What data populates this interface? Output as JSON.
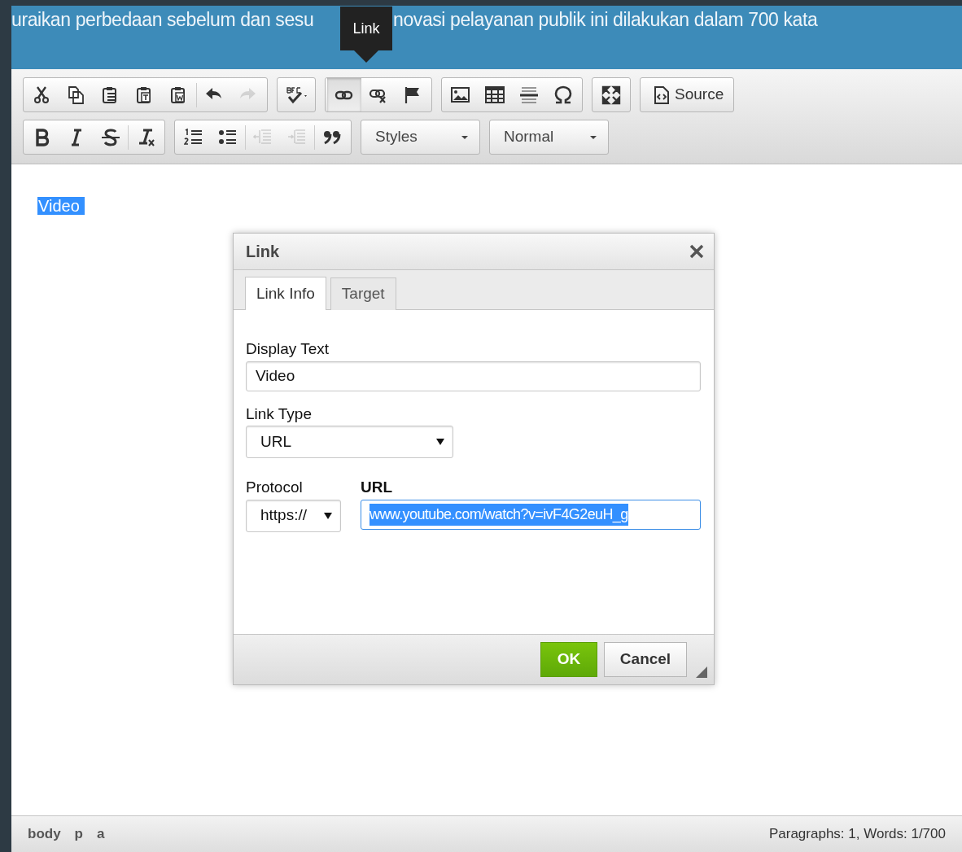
{
  "header": {
    "text_before": "uraikan perbedaan sebelum dan sesu",
    "text_after": "novasi pelayanan publik ini dilakukan dalam 700 kata"
  },
  "tooltip": {
    "text": "Link"
  },
  "toolbar": {
    "rows": [
      {
        "groups": [
          {
            "items": [
              {
                "kind": "cut",
                "disabled": false,
                "pressed": false
              },
              {
                "kind": "copy",
                "disabled": false,
                "pressed": false
              },
              {
                "kind": "paste",
                "disabled": false,
                "pressed": false
              },
              {
                "kind": "paste-text",
                "disabled": false,
                "pressed": false
              },
              {
                "kind": "paste-word",
                "disabled": false,
                "pressed": false
              },
              {
                "kind": "separator"
              },
              {
                "kind": "undo",
                "disabled": false,
                "pressed": false
              },
              {
                "kind": "redo",
                "disabled": true,
                "pressed": false
              }
            ]
          },
          {
            "items": [
              {
                "kind": "spellcheck",
                "disabled": false,
                "pressed": false
              }
            ]
          },
          {
            "items": [
              {
                "kind": "link",
                "disabled": false,
                "pressed": true
              },
              {
                "kind": "unlink",
                "disabled": false,
                "pressed": false
              },
              {
                "kind": "anchor",
                "disabled": false,
                "pressed": false
              }
            ]
          },
          {
            "items": [
              {
                "kind": "image",
                "disabled": false,
                "pressed": false
              },
              {
                "kind": "table",
                "disabled": false,
                "pressed": false
              },
              {
                "kind": "hr",
                "disabled": false,
                "pressed": false
              },
              {
                "kind": "omega",
                "disabled": false,
                "pressed": false
              }
            ]
          },
          {
            "items": [
              {
                "kind": "maximize",
                "disabled": false,
                "pressed": false
              }
            ]
          },
          {
            "items": [
              {
                "kind": "source",
                "label": "Source",
                "disabled": false,
                "pressed": false
              }
            ]
          }
        ]
      },
      {
        "groups": [
          {
            "items": [
              {
                "kind": "bold",
                "disabled": false,
                "pressed": false
              },
              {
                "kind": "italic",
                "disabled": false,
                "pressed": false
              },
              {
                "kind": "strike",
                "disabled": false,
                "pressed": false
              },
              {
                "kind": "separator"
              },
              {
                "kind": "removeformat",
                "disabled": false,
                "pressed": false
              }
            ]
          },
          {
            "items": [
              {
                "kind": "numlist",
                "disabled": false,
                "pressed": false
              },
              {
                "kind": "bullist",
                "disabled": false,
                "pressed": false
              },
              {
                "kind": "separator"
              },
              {
                "kind": "outdent",
                "disabled": true,
                "pressed": false
              },
              {
                "kind": "indent",
                "disabled": true,
                "pressed": false
              },
              {
                "kind": "separator"
              },
              {
                "kind": "quote",
                "disabled": false,
                "pressed": false
              }
            ]
          },
          {
            "items": [
              {
                "kind": "combo",
                "label": "Styles"
              }
            ]
          },
          {
            "items": [
              {
                "kind": "combo",
                "label": "Normal"
              }
            ]
          }
        ]
      }
    ]
  },
  "content": {
    "text": "Video",
    "selected": true
  },
  "dialog": {
    "title": "Link",
    "tabs": [
      {
        "label": "Link Info",
        "selected": true
      },
      {
        "label": "Target",
        "selected": false
      }
    ],
    "display_text": {
      "label": "Display Text",
      "value": "Video"
    },
    "link_type": {
      "label": "Link Type",
      "value": "URL"
    },
    "protocol": {
      "label": "Protocol",
      "value": "https://"
    },
    "url": {
      "label": "URL",
      "value": "www.youtube.com/watch?v=ivF4G2euH_g",
      "focused": true
    },
    "buttons": [
      {
        "label": "OK",
        "kind": "primary"
      },
      {
        "label": "Cancel",
        "kind": "secondary"
      }
    ]
  },
  "status_bar": {
    "path": [
      "body",
      "p",
      "a"
    ],
    "info": "Paragraphs: 1, Words: 1/700"
  }
}
